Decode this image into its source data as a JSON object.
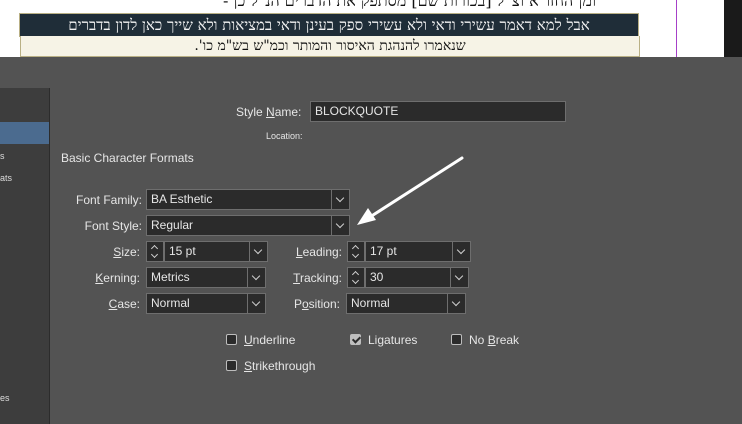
{
  "document": {
    "line1": "ומן החזו\"א וצ\"ל [בכורות שם] מסתפק את הדברים הנ\"ל כן -",
    "line2": "אבל למא דאמר עשירי ודאי ולא עשירי ספק בעינן ודאי במציאות ולא שייך כאן לדון בדברים",
    "line3": "שנאמרו להנהגת האיסור והמותר וכמ\"ש בש\"מ כו'."
  },
  "sidebar": {
    "fragments": [
      "s",
      "ats",
      "es"
    ]
  },
  "style": {
    "name_label_pre": "Style ",
    "name_label_key": "N",
    "name_label_post": "ame:",
    "name_value": "BLOCKQUOTE",
    "location_label": "Location:"
  },
  "section_title": "Basic Character Formats",
  "fields": {
    "font_family": {
      "label": "Font Family:",
      "value": "BA Esthetic"
    },
    "font_style": {
      "label": "Font Style:",
      "value": "Regular"
    },
    "size": {
      "label_key": "S",
      "label_post": "ize:",
      "value": "15 pt"
    },
    "leading": {
      "label_key": "L",
      "label_post": "eading:",
      "value": "17 pt"
    },
    "kerning": {
      "label_key": "K",
      "label_post": "erning:",
      "value": "Metrics"
    },
    "tracking": {
      "label_key": "T",
      "label_post": "racking:",
      "value": "30"
    },
    "case": {
      "label_key": "C",
      "label_post": "ase:",
      "value": "Normal"
    },
    "position": {
      "label_pre": "P",
      "label_key": "o",
      "label_post": "sition:",
      "value": "Normal"
    }
  },
  "checkboxes": {
    "underline": {
      "key": "U",
      "post": "nderline",
      "checked": false
    },
    "ligatures": {
      "pre": "Li",
      "key": "g",
      "post": "atures",
      "checked": true
    },
    "no_break": {
      "pre": "No ",
      "key": "B",
      "post": "reak",
      "checked": false
    },
    "strikethrough": {
      "key": "S",
      "post": "trikethrough",
      "checked": false
    }
  },
  "colors": {
    "panel": "#535353",
    "field": "#2b2b2b",
    "selection": "#4b6b8f",
    "arrow": "#ffffff"
  }
}
